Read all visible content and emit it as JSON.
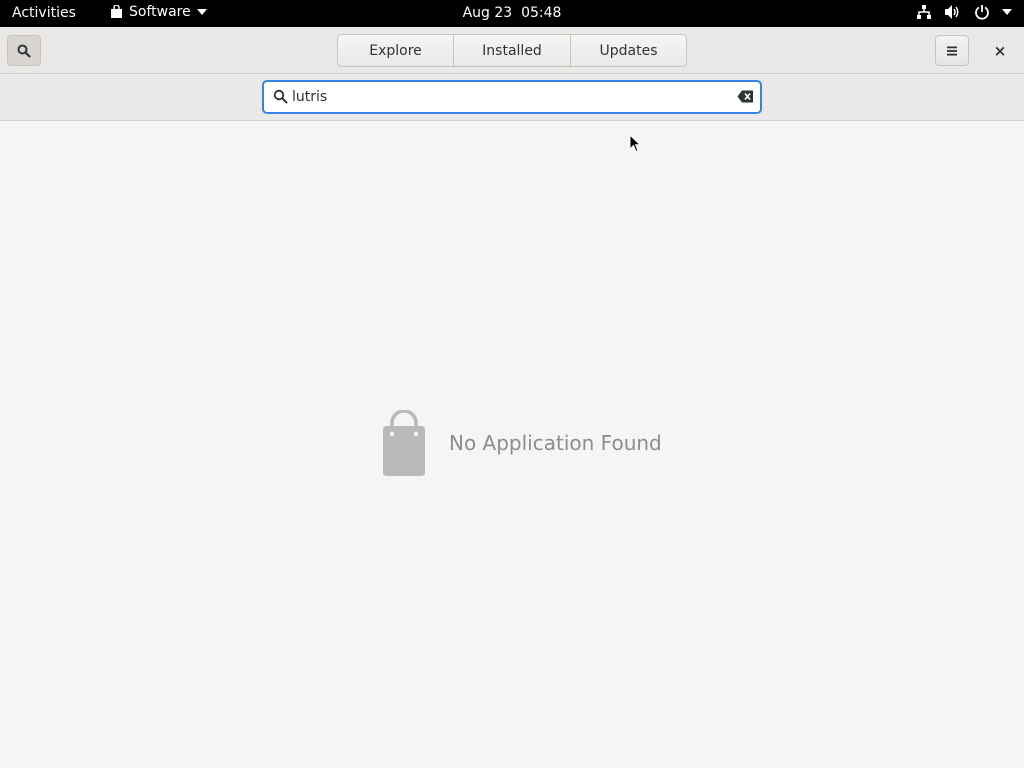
{
  "topbar": {
    "activities": "Activities",
    "app_name": "Software",
    "clock": "Aug 23  05:48",
    "icons": [
      "network-icon",
      "volume-icon",
      "power-icon"
    ]
  },
  "header": {
    "tabs": [
      {
        "label": "Explore"
      },
      {
        "label": "Installed"
      },
      {
        "label": "Updates"
      }
    ],
    "close_label": "×"
  },
  "search": {
    "value": "lutris",
    "placeholder": ""
  },
  "empty_state": {
    "message": "No Application Found",
    "icon": "shopping-bag-icon"
  },
  "colors": {
    "accent": "#3584e4",
    "topbar": "#000000",
    "background": "#f6f5f4",
    "muted_text": "#8b8e8f",
    "bag_icon": "#b7b9ba"
  }
}
